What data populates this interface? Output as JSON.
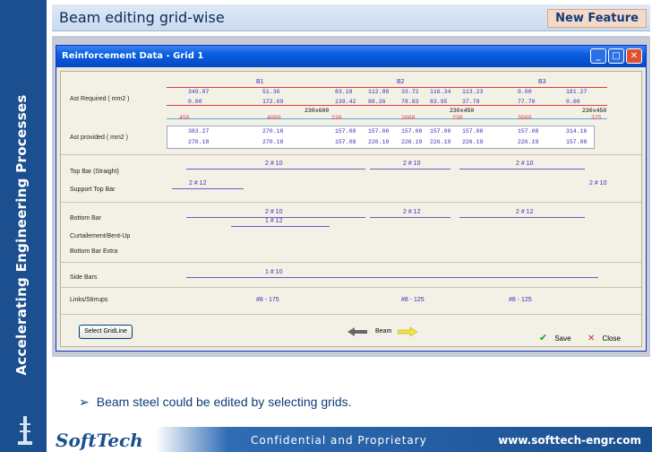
{
  "sidebar": {
    "text": "Accelerating Engineering Processes"
  },
  "header": {
    "title": "Beam editing grid-wise",
    "badge": "New Feature"
  },
  "window": {
    "title": "Reinforcement Data - Grid 1",
    "controls": [
      "_",
      "□",
      "✕"
    ]
  },
  "grid": {
    "spans": [
      "B1",
      "B2",
      "B3"
    ],
    "labels": {
      "ast_required": "Ast Required ( mm2 )",
      "ast_provided": "Ast provided ( mm2 )",
      "top_bar": "Top Bar (Straight)",
      "support_top_bar": "Support Top Bar",
      "bottom_bar": "Bottom Bar",
      "curtailment": "Curtailement/Bent-Up",
      "bottom_bar_extra": "Bottom Bar Extra",
      "side_bars": "Side Bars",
      "links": "Links/Stirrups"
    },
    "required_top": [
      "349.97",
      "51.36",
      "83.19",
      "112.80",
      "33.72",
      "116.34",
      "113.23",
      "0.00",
      "181.27"
    ],
    "required_bottom": [
      "0.00",
      "172.69",
      "139.42",
      "88.26",
      "78.83",
      "83.95",
      "37.78",
      "77.70",
      "0.00"
    ],
    "sections": [
      "230x600",
      "230x450",
      "230x450"
    ],
    "lengths": [
      "450",
      "4000",
      "230",
      "2000",
      "230",
      "3000",
      "375"
    ],
    "provided_top": [
      "383.27",
      "270.18",
      "157.08",
      "157.08",
      "157.08",
      "157.08",
      "157.08",
      "157.08",
      "314.16"
    ],
    "provided_bottom": [
      "270.18",
      "270.18",
      "157.08",
      "226.19",
      "226.19",
      "226.19",
      "226.19",
      "226.19",
      "157.08"
    ],
    "top_bar": [
      "2 # 10",
      "2 # 10",
      "2 # 10"
    ],
    "support_top": [
      "2 # 12",
      "2 # 10"
    ],
    "bottom_bar": [
      "2 # 10",
      "1 # 12",
      "2 # 12",
      "2 # 12"
    ],
    "side_bars": [
      "1 # 10"
    ],
    "links": [
      "#8 - 175",
      "#8 - 125",
      "#8 - 125"
    ]
  },
  "buttons": {
    "select_gridline": "Select GridLine",
    "beam": "Beam",
    "save": "Save",
    "close": "Close"
  },
  "bullet": {
    "text": "Beam steel could be edited by selecting grids."
  },
  "footer": {
    "logo": "SoftTech",
    "center": "Confidential and Proprietary",
    "url": "www.softtech-engr.com"
  }
}
